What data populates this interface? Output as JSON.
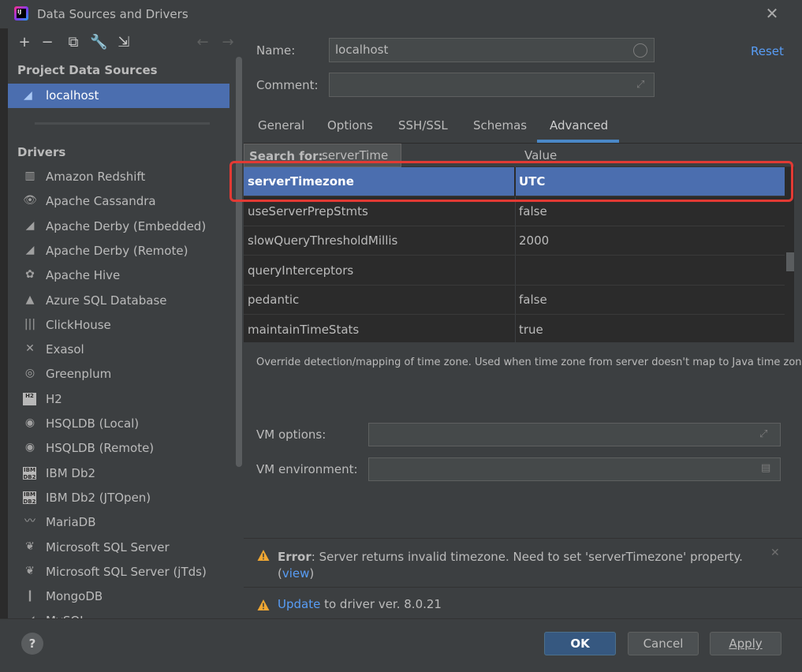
{
  "window": {
    "title": "Data Sources and Drivers",
    "close_icon": "close-icon"
  },
  "left": {
    "project_title": "Project Data Sources",
    "data_source": {
      "label": "localhost"
    },
    "drivers_title": "Drivers",
    "drivers": [
      {
        "label": "Amazon Redshift",
        "icon": "redshift-icon",
        "glyph": "▥"
      },
      {
        "label": "Apache Cassandra",
        "icon": "cassandra-icon",
        "glyph": "👁"
      },
      {
        "label": "Apache Derby (Embedded)",
        "icon": "derby-icon",
        "glyph": "◢"
      },
      {
        "label": "Apache Derby (Remote)",
        "icon": "derby-remote-icon",
        "glyph": "◢"
      },
      {
        "label": "Apache Hive",
        "icon": "hive-icon",
        "glyph": "✿"
      },
      {
        "label": "Azure SQL Database",
        "icon": "azure-icon",
        "glyph": "▲"
      },
      {
        "label": "ClickHouse",
        "icon": "clickhouse-icon",
        "glyph": "|||"
      },
      {
        "label": "Exasol",
        "icon": "exasol-icon",
        "glyph": "✕"
      },
      {
        "label": "Greenplum",
        "icon": "greenplum-icon",
        "glyph": "◎"
      },
      {
        "label": "H2",
        "icon": "h2-icon",
        "glyph": "H2",
        "box": true
      },
      {
        "label": "HSQLDB (Local)",
        "icon": "hsqldb-icon",
        "glyph": "◉"
      },
      {
        "label": "HSQLDB (Remote)",
        "icon": "hsqldb-remote-icon",
        "glyph": "◉"
      },
      {
        "label": "IBM Db2",
        "icon": "db2-icon",
        "glyph": "IBM DB2",
        "box": true
      },
      {
        "label": "IBM Db2 (JTOpen)",
        "icon": "db2-jtopen-icon",
        "glyph": "IBM DB2",
        "box": true
      },
      {
        "label": "MariaDB",
        "icon": "mariadb-icon",
        "glyph": "〰"
      },
      {
        "label": "Microsoft SQL Server",
        "icon": "mssql-icon",
        "glyph": "❦"
      },
      {
        "label": "Microsoft SQL Server (jTds)",
        "icon": "mssql-jtds-icon",
        "glyph": "❦"
      },
      {
        "label": "MongoDB",
        "icon": "mongodb-icon",
        "glyph": "❙"
      },
      {
        "label": "MySQL",
        "icon": "mysql-icon",
        "glyph": "◢"
      }
    ]
  },
  "form": {
    "name_label": "Name:",
    "name_value": "localhost",
    "comment_label": "Comment:",
    "comment_value": "",
    "reset_label": "Reset"
  },
  "tabs": [
    "General",
    "Options",
    "SSH/SSL",
    "Schemas",
    "Advanced"
  ],
  "active_tab": "Advanced",
  "table": {
    "value_header": "Value",
    "search_label": "Search for:",
    "search_value": "serverTime",
    "rows": [
      {
        "key": "serverTimezone",
        "value": "UTC",
        "selected": true
      },
      {
        "key": "useServerPrepStmts",
        "value": "false"
      },
      {
        "key": "slowQueryThresholdMillis",
        "value": "2000"
      },
      {
        "key": "queryInterceptors",
        "value": ""
      },
      {
        "key": "pedantic",
        "value": "false"
      },
      {
        "key": "maintainTimeStats",
        "value": "true"
      }
    ]
  },
  "description": "Override detection/mapping of time zone. Used when time zone from server doesn't map to Java time zone",
  "vm": {
    "options_label": "VM options:",
    "options_value": "",
    "environment_label": "VM environment:",
    "environment_value": ""
  },
  "notifications": {
    "error_prefix": "Error",
    "error_text": ": Server returns invalid timezone. Need to set 'serverTimezone' property.",
    "error_open": "(",
    "error_link": "view",
    "error_close": ")",
    "update_link": "Update",
    "update_text": " to driver ver. 8.0.21"
  },
  "buttons": {
    "ok": "OK",
    "cancel": "Cancel",
    "apply": "Apply",
    "help": "?"
  },
  "colors": {
    "selection": "#4b6eaf",
    "accent": "#589df6",
    "highlight": "#e23a34",
    "warning": "#f0a732"
  }
}
